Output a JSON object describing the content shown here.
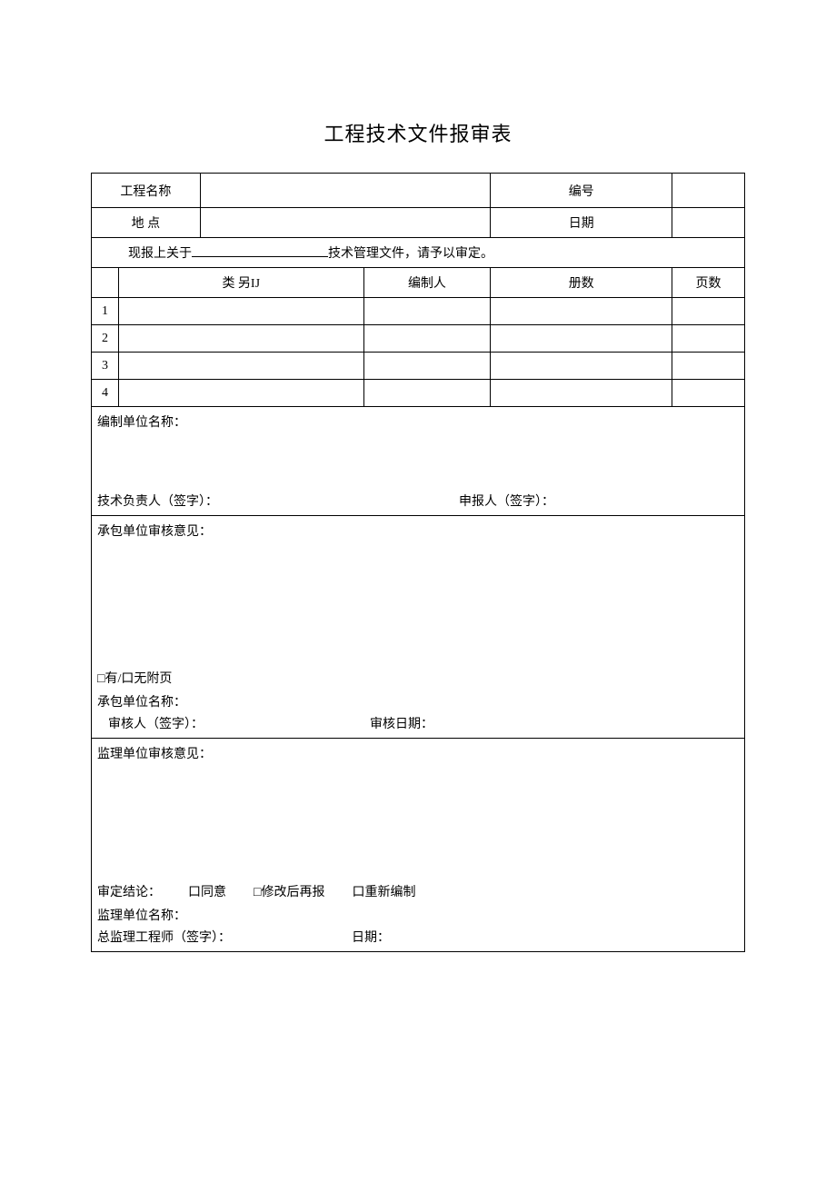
{
  "title": "工程技术文件报审表",
  "header": {
    "project_name_label": "工程名称",
    "project_name_value": "",
    "number_label": "编号",
    "number_value": "",
    "location_label": "地 点",
    "location_value": "",
    "date_label": "日期",
    "date_value": ""
  },
  "submission_line": {
    "prefix": "现报上关于",
    "blank": "",
    "suffix": "技术管理文件，请予以审定。"
  },
  "list_headers": {
    "category": "类 另IJ",
    "compiler": "编制人",
    "volumes": "册数",
    "pages": "页数"
  },
  "list_rows": [
    {
      "no": "1",
      "category": "",
      "compiler": "",
      "volumes": "",
      "pages": ""
    },
    {
      "no": "2",
      "category": "",
      "compiler": "",
      "volumes": "",
      "pages": ""
    },
    {
      "no": "3",
      "category": "",
      "compiler": "",
      "volumes": "",
      "pages": ""
    },
    {
      "no": "4",
      "category": "",
      "compiler": "",
      "volumes": "",
      "pages": ""
    }
  ],
  "compile_section": {
    "org_label": "编制单位名称：",
    "tech_lead_label": "技术负责人（签字）：",
    "applicant_label": "申报人（签字）："
  },
  "contractor_section": {
    "opinion_label": "承包单位审核意见：",
    "attachment_line": "□有/口无附页",
    "org_label": "承包单位名称：",
    "reviewer_label": "审核人（签字）：",
    "review_date_label": "审核日期："
  },
  "supervisor_section": {
    "opinion_label": "监理单位审核意见：",
    "conclusion_label": "审定结论：",
    "opt_agree": "口同意",
    "opt_revise": "□修改后再报",
    "opt_redo": "口重新编制",
    "org_label": "监理单位名称：",
    "engineer_label": "总监理工程师（签字）：",
    "date_label": "日期："
  }
}
